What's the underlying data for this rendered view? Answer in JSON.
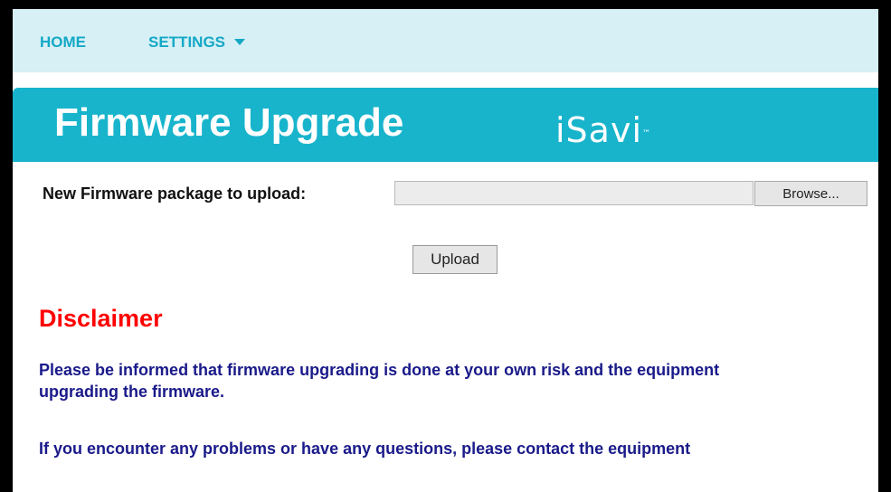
{
  "nav": {
    "home_label": "HOME",
    "settings_label": "SETTINGS"
  },
  "banner": {
    "title": "Firmware Upgrade",
    "brand": "iSavi",
    "trademark": "™"
  },
  "upload": {
    "label": "New Firmware package to upload:",
    "file_value": "",
    "browse_label": "Browse...",
    "upload_label": "Upload"
  },
  "disclaimer": {
    "heading": "Disclaimer",
    "paragraph1_line1": "Please be informed that firmware upgrading is done at your own risk and the equipment",
    "paragraph1_line2": "upgrading the firmware.",
    "paragraph2": "If you encounter any problems or have any questions, please contact the equipment"
  },
  "colors": {
    "nav_background": "#d6f0f5",
    "nav_text": "#14a8c7",
    "banner_background": "#18b4cc",
    "disclaimer_heading": "#ff0000",
    "disclaimer_text": "#1a1a8a"
  },
  "icons": {
    "settings_dropdown": "chevron-down-icon"
  }
}
